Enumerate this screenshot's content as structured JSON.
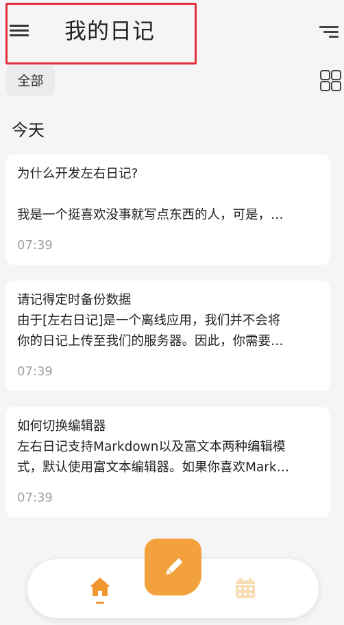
{
  "header": {
    "title": "我的日记",
    "menu_icon": "hamburger-menu-icon",
    "sort_icon": "sort-lines-icon"
  },
  "filter": {
    "active_chip": "全部",
    "layout_icon": "grid-view-icon"
  },
  "section": {
    "title": "今天"
  },
  "entries": [
    {
      "title": "为什么开发左右日记?",
      "lines": [
        "",
        "我是一个挺喜欢没事就写点东西的人，可是，…"
      ],
      "time": "07:39"
    },
    {
      "title": "请记得定时备份数据",
      "lines": [
        "由于[左右日记]是一个离线应用，我们并不会将",
        "你的日记上传至我们的服务器。因此，你需要…"
      ],
      "time": "07:39"
    },
    {
      "title": "如何切换编辑器",
      "lines": [
        "左右日记支持Markdown以及富文本两种编辑模",
        "式，默认使用富文本编辑器。如果你喜欢Mark…"
      ],
      "time": "07:39"
    }
  ],
  "bottom_nav": {
    "home_icon": "home-icon",
    "calendar_icon": "calendar-icon",
    "new_entry_icon": "pencil-icon"
  },
  "colors": {
    "accent": "#f3a13c",
    "highlight": "#e0323c",
    "background": "#f5f5f7",
    "time_text": "#a0a0a0"
  }
}
